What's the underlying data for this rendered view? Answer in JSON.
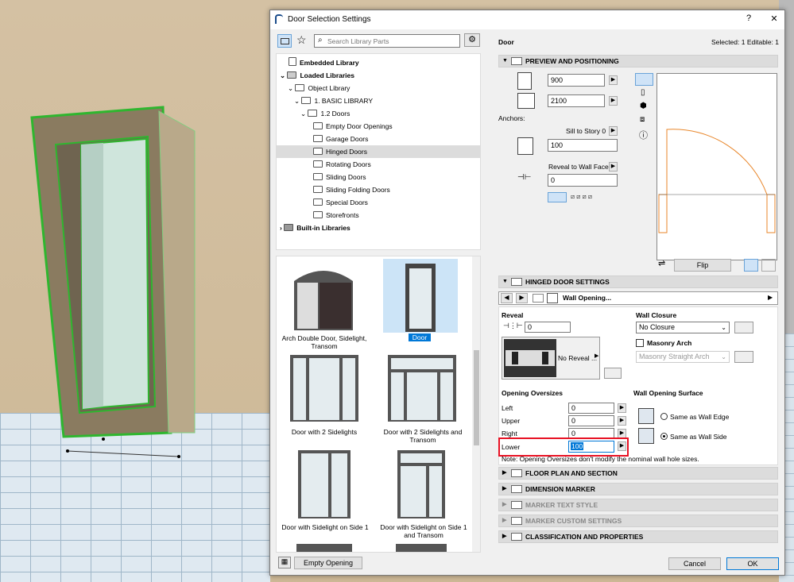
{
  "window": {
    "title": "Door Selection Settings",
    "help": "?",
    "close": "✕"
  },
  "search": {
    "placeholder": "Search Library Parts"
  },
  "tree": [
    {
      "label": "Embedded Library",
      "bold": true
    },
    {
      "label": "Loaded Libraries",
      "bold": true
    },
    {
      "label": "Object Library"
    },
    {
      "label": "1. BASIC LIBRARY"
    },
    {
      "label": "1.2 Doors"
    },
    {
      "label": "Empty Door Openings"
    },
    {
      "label": "Garage Doors"
    },
    {
      "label": "Hinged Doors"
    },
    {
      "label": "Rotating Doors"
    },
    {
      "label": "Sliding Doors"
    },
    {
      "label": "Sliding Folding Doors"
    },
    {
      "label": "Special Doors"
    },
    {
      "label": "Storefronts"
    },
    {
      "label": "Built-in Libraries",
      "bold": true
    }
  ],
  "thumbs": [
    {
      "label": "Arch Double Door, Sidelight, Transom"
    },
    {
      "label": "Door"
    },
    {
      "label": "Door with 2 Sidelights"
    },
    {
      "label": "Door with 2 Sidelights and Transom"
    },
    {
      "label": "Door with Sidelight on Side 1"
    },
    {
      "label": "Door with Sidelight on Side 1 and Transom"
    }
  ],
  "bottom": {
    "empty_opening": "Empty Opening",
    "cancel": "Cancel",
    "ok": "OK"
  },
  "header": {
    "name": "Door",
    "selected": "Selected: 1 Editable: 1"
  },
  "preview": {
    "title": "PREVIEW AND POSITIONING",
    "width": "900",
    "height": "2100",
    "anchors": "Anchors:",
    "sill_label": "Sill to Story 0",
    "sill_value": "100",
    "reveal_label": "Reveal to Wall Face",
    "reveal_value": "0",
    "flip": "Flip"
  },
  "hinged": {
    "title": "HINGED DOOR SETTINGS",
    "page": "Wall Opening..."
  },
  "reveal": {
    "title": "Reveal",
    "value": "0",
    "preset": "No Reveal ..."
  },
  "closure": {
    "title": "Wall Closure",
    "value": "No Closure",
    "masonry": "Masonry Arch",
    "masonry_value": "Masonry Straight Arch"
  },
  "oversizes": {
    "title": "Opening Oversizes",
    "left": "Left",
    "left_v": "0",
    "upper": "Upper",
    "upper_v": "0",
    "right": "Right",
    "right_v": "0",
    "lower": "Lower",
    "lower_v": "100"
  },
  "surface": {
    "title": "Wall Opening Surface",
    "edge": "Same as Wall Edge",
    "side": "Same as Wall Side"
  },
  "note": "Note: Opening Oversizes don't modify the nominal wall hole sizes.",
  "sections": [
    "FLOOR PLAN AND SECTION",
    "DIMENSION MARKER",
    "MARKER TEXT STYLE",
    "MARKER CUSTOM SETTINGS",
    "CLASSIFICATION AND PROPERTIES"
  ],
  "colors": {
    "accent": "#0078d7",
    "highlight": "#e81123",
    "door_plan": "#e8862a"
  }
}
